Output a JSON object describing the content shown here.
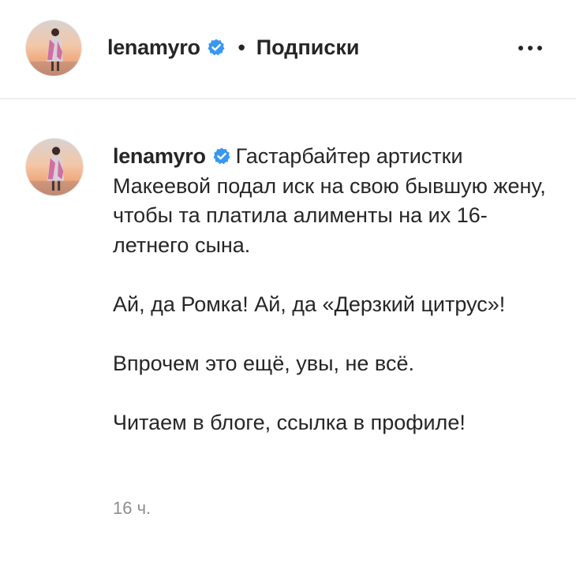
{
  "header": {
    "username": "lenamyro",
    "separator": "•",
    "follow_label": "Подписки",
    "verified_icon": "verified-badge-icon",
    "more_icon": "more-options-icon"
  },
  "post": {
    "username": "lenamyro",
    "verified_icon": "verified-badge-icon",
    "first_paragraph": "Гастарбайтер артистки Макеевой подал иск на свою бывшую жену, чтобы та платила алименты на их 16-летнего сына.",
    "paragraphs": [
      "Ай, да Ромка! Ай, да «Дерзкий цитрус»!",
      "Впрочем это ещё, увы, не всё.",
      "Читаем в блоге, ссылка в профиле!"
    ],
    "timestamp": "16 ч."
  },
  "colors": {
    "text": "#262626",
    "muted": "#8e8e8e",
    "verified_blue": "#3897f0",
    "divider": "#efefef"
  }
}
